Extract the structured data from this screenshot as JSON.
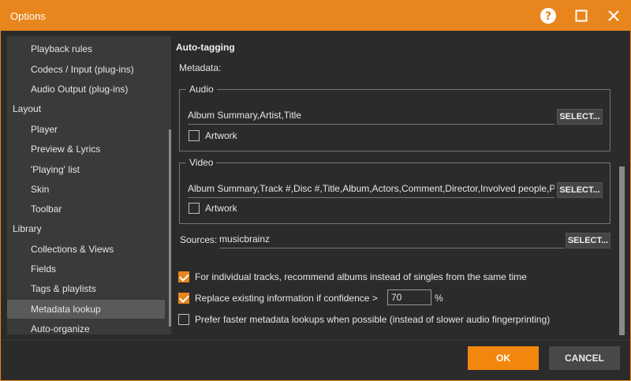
{
  "window": {
    "title": "Options",
    "accent": "#e8851c",
    "icons": {
      "help": "help-icon",
      "maximize": "maximize-icon",
      "close": "close-icon"
    }
  },
  "sidebar": {
    "items": [
      {
        "label": "Playback rules",
        "level": 1
      },
      {
        "label": "Codecs / Input (plug-ins)",
        "level": 1
      },
      {
        "label": "Audio Output (plug-ins)",
        "level": 1
      },
      {
        "label": "Layout",
        "level": 0
      },
      {
        "label": "Player",
        "level": 1
      },
      {
        "label": "Preview & Lyrics",
        "level": 1
      },
      {
        "label": "'Playing' list",
        "level": 1
      },
      {
        "label": "Skin",
        "level": 1
      },
      {
        "label": "Toolbar",
        "level": 1
      },
      {
        "label": "Library",
        "level": 0
      },
      {
        "label": "Collections & Views",
        "level": 1
      },
      {
        "label": "Fields",
        "level": 1
      },
      {
        "label": "Tags & playlists",
        "level": 1
      },
      {
        "label": "Metadata lookup",
        "level": 1,
        "selected": true
      },
      {
        "label": "Auto-organize",
        "level": 1
      }
    ]
  },
  "main": {
    "section_title": "Auto-tagging",
    "metadata_label": "Metadata:",
    "audio": {
      "legend": "Audio",
      "fields_value": "Album Summary,Artist,Title",
      "select_label": "SELECT...",
      "artwork_label": "Artwork",
      "artwork_checked": false
    },
    "video": {
      "legend": "Video",
      "fields_value": "Album Summary,Track #,Disc #,Title,Album,Actors,Comment,Director,Involved people,Produc",
      "select_label": "SELECT...",
      "artwork_label": "Artwork",
      "artwork_checked": false
    },
    "sources": {
      "label": "Sources:",
      "value": "musicbrainz",
      "select_label": "SELECT..."
    },
    "options": [
      {
        "label": "For individual tracks, recommend albums instead of singles from the same time",
        "checked": true
      },
      {
        "label": "Replace existing information if confidence >",
        "checked": true,
        "value": "70",
        "suffix": "%"
      },
      {
        "label": "Prefer faster metadata lookups when possible (instead of slower audio fingerprinting)",
        "checked": false
      }
    ]
  },
  "footer": {
    "ok_label": "OK",
    "cancel_label": "CANCEL"
  }
}
